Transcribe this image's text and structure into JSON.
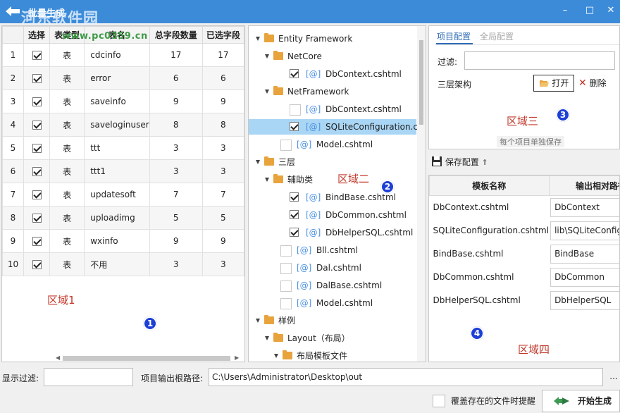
{
  "window": {
    "title": "批量生成",
    "watermark": "河东软件园",
    "watermark_url": "www.pc0359.cn",
    "minimize": "–",
    "maximize": "□",
    "close": "✕"
  },
  "tables": {
    "columns": [
      "",
      "选择",
      "表类型",
      "表名",
      "总字段数量",
      "已选字段"
    ],
    "rows": [
      {
        "idx": "1",
        "checked": true,
        "type": "表",
        "name": "cdcinfo",
        "total": "17",
        "selected": "17"
      },
      {
        "idx": "2",
        "checked": true,
        "type": "表",
        "name": "error",
        "total": "6",
        "selected": "6"
      },
      {
        "idx": "3",
        "checked": true,
        "type": "表",
        "name": "saveinfo",
        "total": "9",
        "selected": "9"
      },
      {
        "idx": "4",
        "checked": true,
        "type": "表",
        "name": "saveloginuser",
        "total": "8",
        "selected": "8"
      },
      {
        "idx": "5",
        "checked": true,
        "type": "表",
        "name": "ttt",
        "total": "3",
        "selected": "3"
      },
      {
        "idx": "6",
        "checked": true,
        "type": "表",
        "name": "ttt1",
        "total": "3",
        "selected": "3"
      },
      {
        "idx": "7",
        "checked": true,
        "type": "表",
        "name": "updatesoft",
        "total": "7",
        "selected": "7"
      },
      {
        "idx": "8",
        "checked": true,
        "type": "表",
        "name": "uploadimg",
        "total": "5",
        "selected": "5"
      },
      {
        "idx": "9",
        "checked": true,
        "type": "表",
        "name": "wxinfo",
        "total": "9",
        "selected": "9"
      },
      {
        "idx": "10",
        "checked": true,
        "type": "表",
        "name": "不用",
        "total": "3",
        "selected": "3"
      }
    ],
    "area_label": "区域1",
    "badge": "1"
  },
  "tree": {
    "area_label": "区域二",
    "badge": "2",
    "nodes": [
      {
        "label": "Entity Framework",
        "kind": "folder",
        "level": 0,
        "expanded": true
      },
      {
        "label": "NetCore",
        "kind": "folder",
        "level": 1,
        "expanded": true
      },
      {
        "label": "DbContext.cshtml",
        "kind": "file",
        "level": 2,
        "checked": true,
        "prefix": "[@]"
      },
      {
        "label": "NetFramework",
        "kind": "folder",
        "level": 1,
        "expanded": true
      },
      {
        "label": "DbContext.cshtml",
        "kind": "file",
        "level": 2,
        "checked": false,
        "prefix": "[@]"
      },
      {
        "label": "SQLiteConfiguration.cshtml",
        "kind": "file",
        "level": 2,
        "checked": true,
        "prefix": "[@]",
        "selected": true
      },
      {
        "label": "Model.cshtml",
        "kind": "file",
        "level": 1,
        "checked": false,
        "prefix": "[@]"
      },
      {
        "label": "三层",
        "kind": "folder",
        "level": 0,
        "expanded": true
      },
      {
        "label": "辅助类",
        "kind": "folder",
        "level": 1,
        "expanded": true
      },
      {
        "label": "BindBase.cshtml",
        "kind": "file",
        "level": 2,
        "checked": true,
        "prefix": "[@]"
      },
      {
        "label": "DbCommon.cshtml",
        "kind": "file",
        "level": 2,
        "checked": true,
        "prefix": "[@]"
      },
      {
        "label": "DbHelperSQL.cshtml",
        "kind": "file",
        "level": 2,
        "checked": true,
        "prefix": "[@]"
      },
      {
        "label": "Bll.cshtml",
        "kind": "file",
        "level": 1,
        "checked": false,
        "prefix": "[@]"
      },
      {
        "label": "Dal.cshtml",
        "kind": "file",
        "level": 1,
        "checked": false,
        "prefix": "[@]"
      },
      {
        "label": "DalBase.cshtml",
        "kind": "file",
        "level": 1,
        "checked": false,
        "prefix": "[@]"
      },
      {
        "label": "Model.cshtml",
        "kind": "file",
        "level": 1,
        "checked": false,
        "prefix": "[@]"
      },
      {
        "label": "样例",
        "kind": "folder",
        "level": 0,
        "expanded": true
      },
      {
        "label": "Layout（布局）",
        "kind": "folder",
        "level": 1,
        "expanded": true
      },
      {
        "label": "布局模板文件",
        "kind": "folder",
        "level": 2,
        "expanded": true
      }
    ]
  },
  "config": {
    "tab_project": "项目配置",
    "tab_global": "全局配置",
    "filter_label": "过滤:",
    "filter_value": "",
    "arch_label": "三层架构",
    "open_button": "打开",
    "delete_button": "删除",
    "area_label": "区域三",
    "badge": "3",
    "hint": "每个项目单独保存",
    "save_label": "保存配置",
    "save_arrow": "⇑"
  },
  "mapping": {
    "columns": [
      "模板名称",
      "输出相对路径"
    ],
    "rows": [
      {
        "template": "DbContext.cshtml",
        "path": "DbContext"
      },
      {
        "template": "SQLiteConfiguration.cshtml",
        "path": "lib\\SQLiteConfiguration"
      },
      {
        "template": "BindBase.cshtml",
        "path": "BindBase"
      },
      {
        "template": "DbCommon.cshtml",
        "path": "DbCommon"
      },
      {
        "template": "DbHelperSQL.cshtml",
        "path": "DbHelperSQL"
      }
    ],
    "area_label": "区域四",
    "badge": "4"
  },
  "footer": {
    "filter_label": "显示过滤:",
    "filter_value": "",
    "root_label": "项目输出根路径:",
    "root_value": "C:\\Users\\Administrator\\Desktop\\out",
    "browse": "...",
    "overwrite_label": "覆盖存在的文件时提醒",
    "overwrite_checked": false,
    "generate_button": "开始生成"
  },
  "colors": {
    "titlebar": "#3c8bd9",
    "selected_row": "#aad6f5",
    "accent_tab": "#2f6cb5",
    "area_label": "#c0392b",
    "badge": "#1c3fd6"
  }
}
